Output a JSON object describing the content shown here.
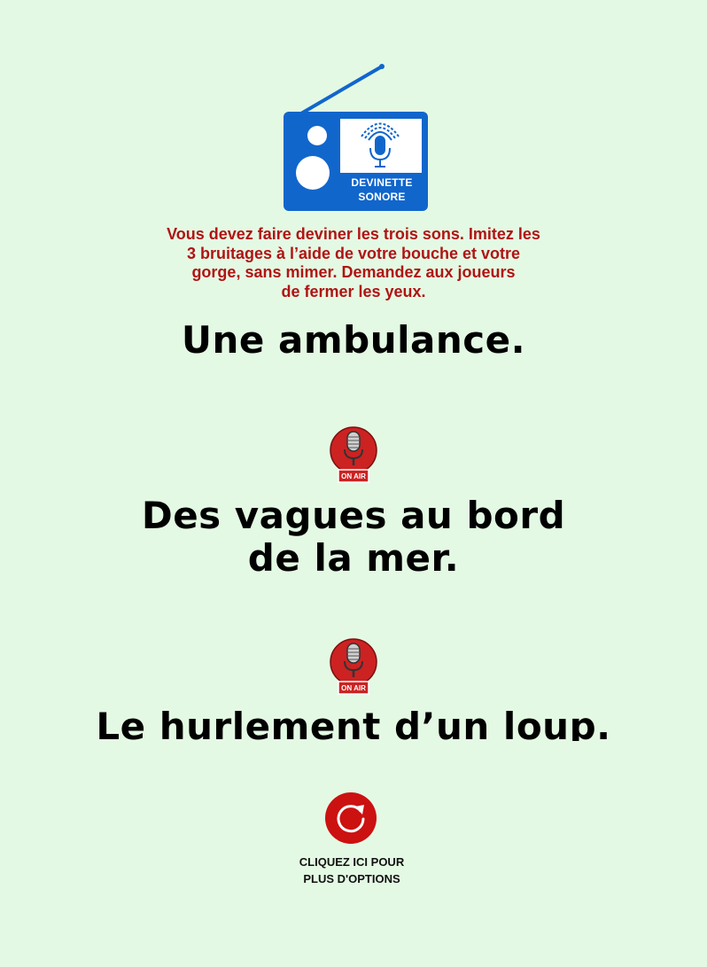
{
  "logo": {
    "line1": "DEVINETTE",
    "line2": "SONORE",
    "icon": "radio-with-microphone-icon",
    "colors": {
      "body": "#1166cc",
      "screen": "#ffffff",
      "accent": "#1166cc"
    }
  },
  "instructions": {
    "lines": [
      "Vous devez faire deviner les trois sons. Imitez les",
      "3 bruitages à l’aide de votre bouche et votre",
      "gorge, sans mimer. Demandez aux joueurs",
      "de fermer les yeux."
    ],
    "color": "#b01414"
  },
  "answers": [
    {
      "lines": [
        "Une ambulance."
      ]
    },
    {
      "lines": [
        "Des vagues au bord",
        "de la mer."
      ]
    },
    {
      "lines": [
        "Le hurlement d’un loup."
      ]
    }
  ],
  "separators": [
    {
      "icon": "on-air-microphone-icon",
      "label": "ON AIR"
    },
    {
      "icon": "on-air-microphone-icon",
      "label": "ON AIR"
    }
  ],
  "options": {
    "icon": "refresh-icon",
    "lines": [
      "CLIQUEZ ICI POUR",
      "PLUS D'OPTIONS"
    ],
    "color": "#cc1111"
  },
  "background": "#e4f9e4"
}
